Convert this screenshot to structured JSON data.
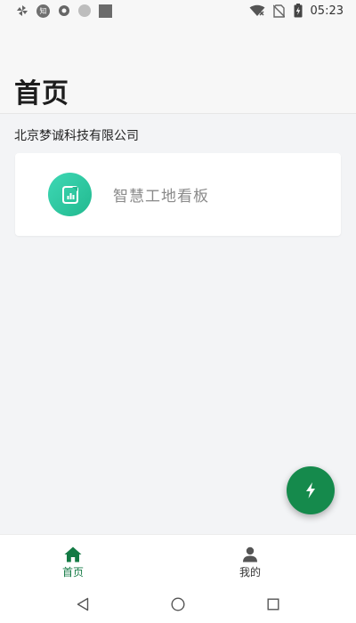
{
  "status_bar": {
    "time": "05:23",
    "left_icons": [
      "pinwheel-icon",
      "zhihu-icon",
      "record-icon",
      "circle-icon",
      "square-icon"
    ],
    "zhihu_glyph": "知",
    "right_icons": [
      "wifi-icon",
      "no-sim-icon",
      "battery-charging-icon"
    ]
  },
  "header": {
    "title": "首页"
  },
  "company": {
    "name": "北京梦诚科技有限公司"
  },
  "apps": [
    {
      "label": "智慧工地看板",
      "icon": "dashboard-icon"
    }
  ],
  "fab": {
    "icon": "lightning-icon"
  },
  "bottom_nav": {
    "items": [
      {
        "label": "首页",
        "icon": "home-icon",
        "active": true
      },
      {
        "label": "我的",
        "icon": "person-icon",
        "active": false
      }
    ]
  },
  "system_nav": [
    "back-icon",
    "home-circle-icon",
    "recents-icon"
  ],
  "colors": {
    "accent": "#137a44",
    "fab": "#158a4c",
    "app_icon": "#2cc9a0",
    "background": "#f3f4f6"
  }
}
